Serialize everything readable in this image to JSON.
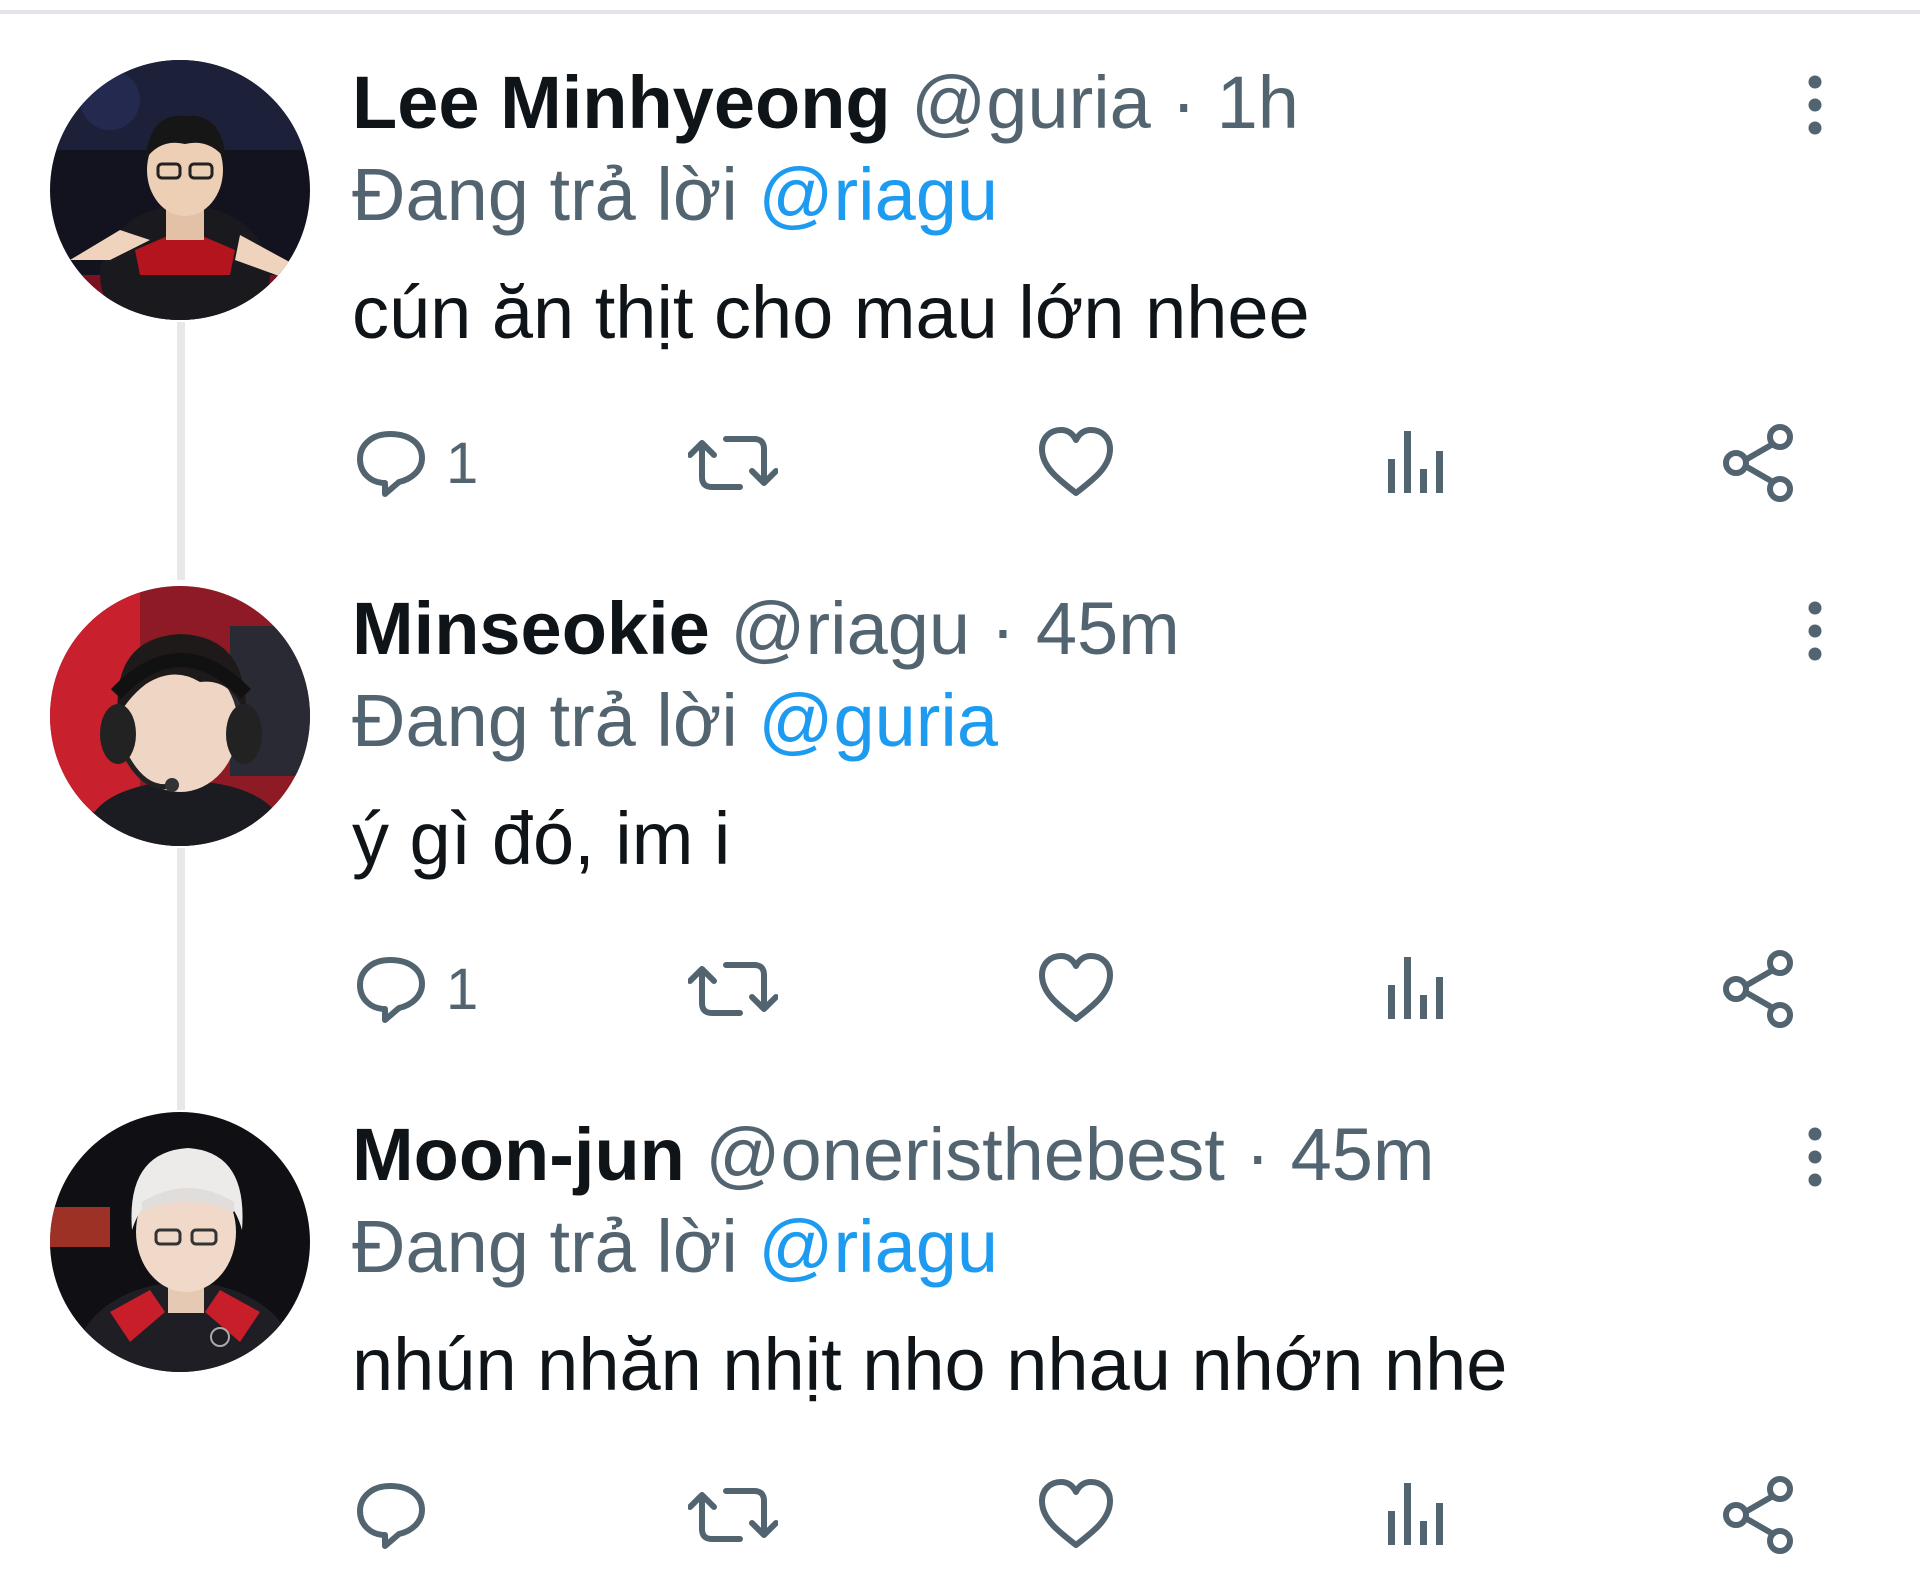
{
  "colors": {
    "text": "#0f1419",
    "muted": "#536471",
    "accent": "#1d9bf0",
    "thread_line": "#e6e8ea"
  },
  "tweets": [
    {
      "name": "Lee Minhyeong",
      "handle": "@guria",
      "separator": "·",
      "time": "1h",
      "reply_prefix": "Đang trả lời",
      "reply_to": "@riagu",
      "text": "cún ăn thịt cho mau lớn nhee",
      "reply_count": "1",
      "icons": [
        "more-icon",
        "reply-icon",
        "retweet-icon",
        "like-icon",
        "views-icon",
        "share-icon"
      ]
    },
    {
      "name": "Minseokie",
      "handle": "@riagu",
      "separator": "·",
      "time": "45m",
      "reply_prefix": "Đang trả lời",
      "reply_to": "@guria",
      "text": "ý gì đó, im i",
      "reply_count": "1",
      "icons": [
        "more-icon",
        "reply-icon",
        "retweet-icon",
        "like-icon",
        "views-icon",
        "share-icon"
      ]
    },
    {
      "name": "Moon-jun",
      "handle": "@oneristhebest",
      "separator": "·",
      "time": "45m",
      "reply_prefix": "Đang trả lời",
      "reply_to": "@riagu",
      "text": "nhún nhăn nhịt nho nhau nhớn nhe",
      "reply_count": "",
      "icons": [
        "more-icon",
        "reply-icon",
        "retweet-icon",
        "like-icon",
        "views-icon",
        "share-icon"
      ]
    }
  ]
}
